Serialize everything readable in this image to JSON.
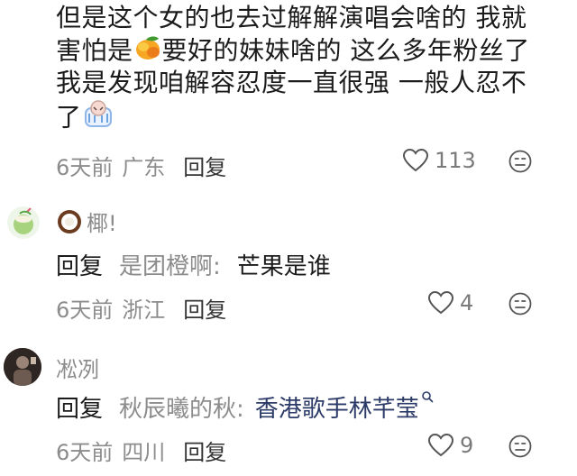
{
  "comment1": {
    "line1": "但是这个女的也去过解解演唱会啥的 我就",
    "line2_a": "害怕是",
    "line2_b": "要好的妹妹啥的 这么多年粉丝了",
    "line3": "我是发现咱解容忍度一直很强 一般人忍不",
    "line4": "了",
    "meta": {
      "time": "6天前",
      "location": "广东",
      "reply": "回复",
      "likes": "113"
    }
  },
  "comment2": {
    "username": "椰!",
    "reply_label": "回复",
    "reply_target": "是团橙啊:",
    "reply_text": "芒果是谁",
    "meta": {
      "time": "6天前",
      "location": "浙江",
      "reply": "回复",
      "likes": "4"
    }
  },
  "comment3": {
    "username": "凇冽",
    "reply_label": "回复",
    "reply_target": "秋辰曦的秋:",
    "reply_text": "香港歌手林芊莹",
    "meta": {
      "time": "6天前",
      "location": "四川",
      "reply": "回复",
      "likes": "9"
    }
  },
  "colors": {
    "text": "#1b1b1b",
    "meta": "#8c8c8c",
    "link": "#2b3a67"
  }
}
